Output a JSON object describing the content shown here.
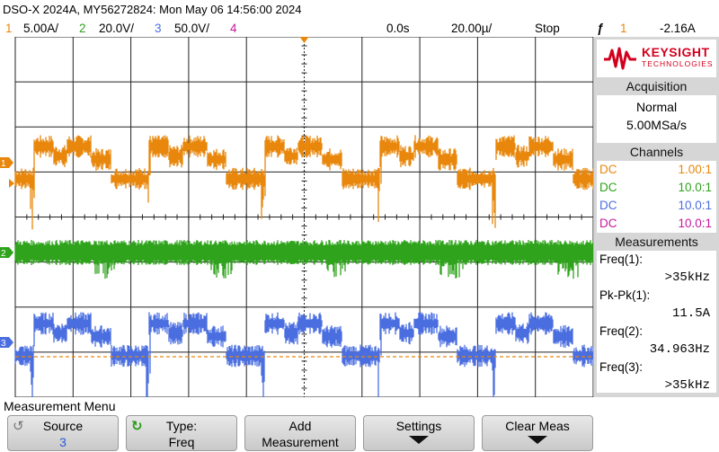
{
  "title": "DSO-X 2024A, MY56272824: Mon May 06 14:56:00 2024",
  "channel_bar": {
    "ch1_num": "1",
    "ch1_scale": "5.00A/",
    "ch2_num": "2",
    "ch2_scale": "20.0V/",
    "ch3_num": "3",
    "ch3_scale": "50.0V/",
    "ch4_num": "4",
    "time_offset": "0.0s",
    "time_scale": "20.00µ/",
    "run_state": "Stop",
    "trigger_icon": "ƒ",
    "trigger_source": "1",
    "trigger_level": "-2.16A"
  },
  "colors": {
    "ch1": "#e8870c",
    "ch2": "#2fa31c",
    "ch3": "#4a6ee0",
    "ch4": "#c8189c",
    "grid": "#222222",
    "trigger_line": "#e8870c"
  },
  "side_panel": {
    "logo_name": "KEYSIGHT",
    "logo_sub": "TECHNOLOGIES",
    "acquisition": {
      "title": "Acquisition",
      "mode": "Normal",
      "rate": "5.00MSa/s"
    },
    "channels": {
      "title": "Channels",
      "rows": [
        {
          "coupling": "DC",
          "probe": "1.00:1"
        },
        {
          "coupling": "DC",
          "probe": "10.0:1"
        },
        {
          "coupling": "DC",
          "probe": "10.0:1"
        },
        {
          "coupling": "DC",
          "probe": "10.0:1"
        }
      ]
    },
    "measurements": {
      "title": "Measurements",
      "items": [
        {
          "label": "Freq(1):",
          "value": ">35kHz"
        },
        {
          "label": "Pk-Pk(1):",
          "value": "11.5A"
        },
        {
          "label": "Freq(2):",
          "value": "34.963Hz"
        },
        {
          "label": "Freq(3):",
          "value": ">35kHz"
        }
      ]
    }
  },
  "menu": {
    "title": "Measurement Menu",
    "softkeys": [
      {
        "label": "Source",
        "value": "3"
      },
      {
        "label": "Type:",
        "value": "Freq"
      },
      {
        "label": "Add",
        "value": "Measurement"
      },
      {
        "label": "Settings"
      },
      {
        "label": "Clear Meas"
      }
    ]
  },
  "marker_labels": {
    "ch1": "1",
    "ch2": "2",
    "ch3": "3"
  }
}
